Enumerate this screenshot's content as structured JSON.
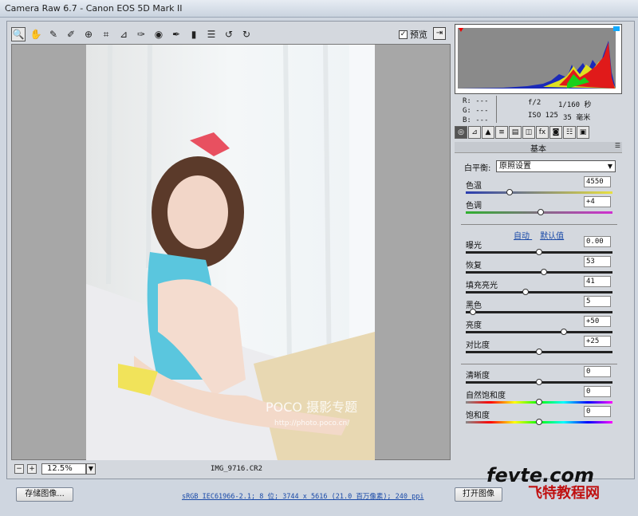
{
  "window": {
    "title": "Camera Raw 6.7 -  Canon EOS 5D Mark II"
  },
  "toolbar": {
    "preview_label": "预览",
    "preview_checked": "✓"
  },
  "canvas": {
    "zoom": "12.5%",
    "filename": "IMG_9716.CR2",
    "watermark_main": "POCO 摄影专题",
    "watermark_url": "http://photo.poco.cn/"
  },
  "readout": {
    "r": "R:  ---",
    "g": "G:  ---",
    "b": "B:  ---",
    "aperture": "f/2",
    "shutter": "1/160 秒",
    "iso": "ISO 125",
    "focal": "35 毫米"
  },
  "panel": {
    "title": "基本",
    "wb_label": "白平衡:",
    "wb_value": "原照设置",
    "auto": "自动",
    "default": "默认值",
    "sliders": [
      {
        "label": "色温",
        "value": "4550",
        "level": 0.3,
        "track": "temp"
      },
      {
        "label": "色调",
        "value": "+4",
        "level": 0.51,
        "track": "tint"
      },
      {
        "label": "曝光",
        "value": "0.00",
        "level": 0.5,
        "track": "dark"
      },
      {
        "label": "恢复",
        "value": "53",
        "level": 0.53,
        "track": "dark"
      },
      {
        "label": "填充亮光",
        "value": "41",
        "level": 0.41,
        "track": "dark"
      },
      {
        "label": "黑色",
        "value": "5",
        "level": 0.05,
        "track": "dark"
      },
      {
        "label": "亮度",
        "value": "+50",
        "level": 0.67,
        "track": "dark"
      },
      {
        "label": "对比度",
        "value": "+25",
        "level": 0.5,
        "track": "dark"
      },
      {
        "label": "清晰度",
        "value": "0",
        "level": 0.5,
        "track": "dark"
      },
      {
        "label": "自然饱和度",
        "value": "0",
        "level": 0.5,
        "track": "sat"
      },
      {
        "label": "饱和度",
        "value": "0",
        "level": 0.5,
        "track": "sat"
      }
    ]
  },
  "footer": {
    "save": "存储图像...",
    "info": "sRGB IEC61966-2.1; 8 位; 3744 x 5616 (21.0 百万像素); 240 ppi",
    "open": "打开图像"
  },
  "watermark": {
    "site": "fevte.com",
    "name": "飞特教程网"
  },
  "colors": {
    "accent": "#1a4aa8",
    "temp_track": "linear-gradient(90deg,#2a3db0,#e8e040)",
    "tint_track": "linear-gradient(90deg,#2fb02f,#d02fd0)",
    "sat_track": "linear-gradient(90deg,#888,#f00,#ff0,#0f0,#0ff,#00f,#f0f)"
  }
}
